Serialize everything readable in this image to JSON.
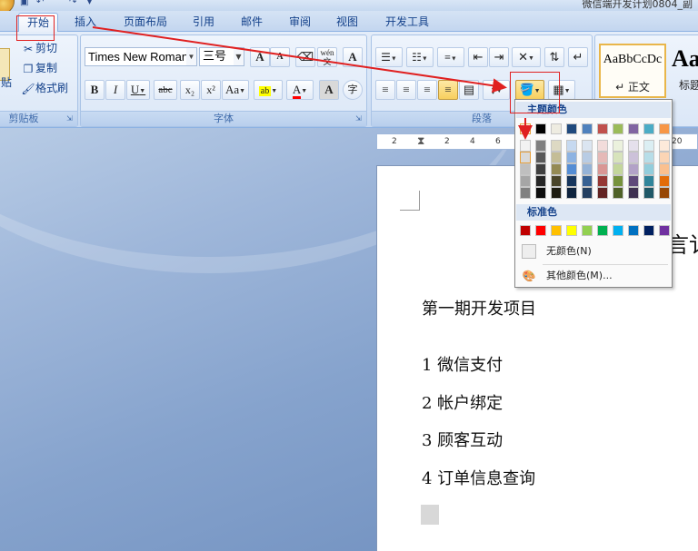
{
  "window": {
    "title": "微信端开发计划0804_副"
  },
  "tabs": [
    {
      "label": "开始",
      "active": true
    },
    {
      "label": "插入"
    },
    {
      "label": "页面布局"
    },
    {
      "label": "引用"
    },
    {
      "label": "邮件"
    },
    {
      "label": "审阅"
    },
    {
      "label": "视图"
    },
    {
      "label": "开发工具"
    }
  ],
  "clipboard": {
    "paste_partial": "贴",
    "cut": "剪切",
    "copy": "复制",
    "format_painter": "格式刷",
    "group_label": "剪贴板"
  },
  "font": {
    "family_value": "Times New Roman",
    "size_value": "三号",
    "group_label": "字体"
  },
  "paragraph": {
    "group_label": "段落"
  },
  "styles": [
    {
      "preview": "AaBbCcDc",
      "name": "↵ 正文"
    },
    {
      "preview": "Aa",
      "name": "标题"
    }
  ],
  "color_dropdown": {
    "theme_header": "主题颜色",
    "standard_header": "标准色",
    "no_color": "无颜色(N)",
    "more_colors": "其他颜色(M)...",
    "theme_top_row": [
      "#ffffff",
      "#000000",
      "#eeece1",
      "#1f497d",
      "#4f81bd",
      "#c0504d",
      "#9bbb59",
      "#8064a2",
      "#4bacc6",
      "#f79646"
    ],
    "theme_columns": [
      [
        "#f2f2f2",
        "#d9d9d9",
        "#bfbfbf",
        "#a6a6a6",
        "#808080"
      ],
      [
        "#7f7f7f",
        "#595959",
        "#404040",
        "#262626",
        "#0d0d0d"
      ],
      [
        "#ddd9c3",
        "#c4bd97",
        "#948a54",
        "#4a452a",
        "#1e1c11"
      ],
      [
        "#c6d9f0",
        "#8db3e2",
        "#548dd4",
        "#17365d",
        "#0f243e"
      ],
      [
        "#dbe5f1",
        "#b8cce4",
        "#95b3d7",
        "#366092",
        "#244061"
      ],
      [
        "#f2dcdb",
        "#e5b9b7",
        "#d99694",
        "#953734",
        "#632423"
      ],
      [
        "#ebf1dd",
        "#d7e3bc",
        "#c3d69b",
        "#76923c",
        "#4f6128"
      ],
      [
        "#e5e0ec",
        "#ccc1d9",
        "#b2a2c7",
        "#5f497a",
        "#3f3151"
      ],
      [
        "#dbeef3",
        "#b7dde8",
        "#92cddc",
        "#31859b",
        "#205867"
      ],
      [
        "#fdeada",
        "#fbd5b5",
        "#fac08f",
        "#e36c09",
        "#974806"
      ]
    ],
    "standard_colors": [
      "#c00000",
      "#ff0000",
      "#ffc000",
      "#ffff00",
      "#92d050",
      "#00b050",
      "#00b0f0",
      "#0070c0",
      "#002060",
      "#7030a0"
    ]
  },
  "ruler": {
    "ticks": [
      "2",
      "2",
      "4",
      "6",
      "20"
    ]
  },
  "document": {
    "partial_title": "言讠",
    "lines": [
      "第一期开发项目",
      "1 微信支付",
      "2 帐户绑定",
      "3 顾客互动",
      "4 订单信息查询"
    ]
  },
  "annotation_color": "#e02020"
}
